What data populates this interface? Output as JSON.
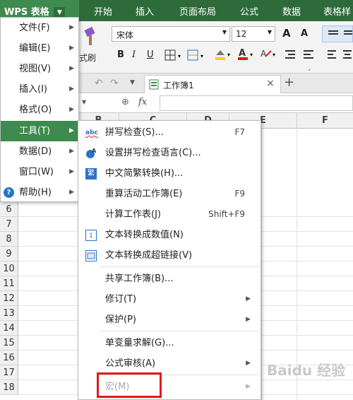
{
  "app": {
    "name": "WPS 表格"
  },
  "ribbon_tabs": [
    "开始",
    "插入",
    "页面布局",
    "公式",
    "数据",
    "表格样"
  ],
  "toolbar": {
    "font_name": "宋体",
    "font_size": "12",
    "format_painter_label": "式刷",
    "bold": "B",
    "italic": "I",
    "underline": "U",
    "grow_font": "A",
    "shrink_font": "A"
  },
  "document_tab": {
    "name": "工作簿1",
    "close": "×",
    "new": "+"
  },
  "formula_bar": {
    "zoom_icon": "⊕",
    "fx": "fx"
  },
  "columns": [
    "B",
    "C",
    "D",
    "E",
    "F"
  ],
  "rows": [
    "6",
    "7",
    "8",
    "9",
    "10",
    "11",
    "12",
    "13",
    "14",
    "15",
    "16",
    "17",
    "18"
  ],
  "main_menu": [
    {
      "label": "文件(F)"
    },
    {
      "label": "编辑(E)"
    },
    {
      "label": "视图(V)"
    },
    {
      "label": "插入(I)"
    },
    {
      "label": "格式(O)"
    },
    {
      "label": "工具(T)",
      "active": true
    },
    {
      "label": "数据(D)"
    },
    {
      "label": "窗口(W)"
    },
    {
      "label": "帮助(H)"
    }
  ],
  "tools_submenu": [
    {
      "label": "拼写检查(S)...",
      "shortcut": "F7",
      "icon": "abc"
    },
    {
      "label": "设置拼写检查语言(C)...",
      "shortcut": "",
      "icon": "lang"
    },
    {
      "label": "中文简繁转换(H)...",
      "shortcut": "",
      "icon": "繁"
    },
    {
      "label": "重算活动工作簿(E)",
      "shortcut": "F9"
    },
    {
      "label": "计算工作表(J)",
      "shortcut": "Shift+F9"
    },
    {
      "label": "文本转换成数值(N)",
      "shortcut": "",
      "icon": "1"
    },
    {
      "label": "文本转换成超链接(V)",
      "shortcut": "",
      "icon": "link"
    },
    {
      "label": "共享工作簿(B)...",
      "shortcut": ""
    },
    {
      "label": "修订(T)",
      "shortcut": ""
    },
    {
      "label": "保护(P)",
      "shortcut": ""
    },
    {
      "label": "单变量求解(G)...",
      "shortcut": ""
    },
    {
      "label": "公式审核(A)",
      "shortcut": ""
    },
    {
      "label": "宏(M)",
      "shortcut": "",
      "disabled": true
    }
  ],
  "watermark": "Baidu 经验",
  "colors": {
    "ribbon": "#2e6b3b",
    "active": "#3f8a4e",
    "highlight": "#e01a1a"
  }
}
